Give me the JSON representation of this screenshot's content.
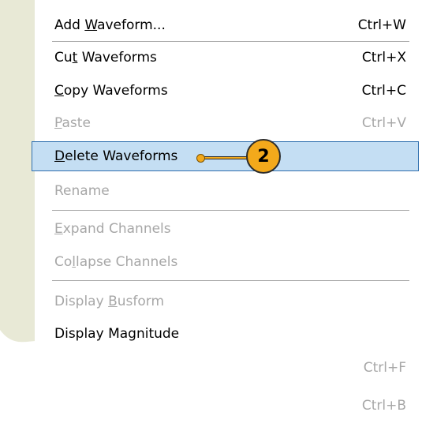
{
  "menu": {
    "items": [
      {
        "label_pre": "Add ",
        "label_u": "W",
        "label_post": "aveform...",
        "shortcut": "Ctrl+W",
        "state": "enabled"
      },
      {
        "label_pre": "Cu",
        "label_u": "t",
        "label_post": " Waveforms",
        "shortcut": "Ctrl+X",
        "state": "enabled"
      },
      {
        "label_pre": "",
        "label_u": "C",
        "label_post": "opy Waveforms",
        "shortcut": "Ctrl+C",
        "state": "enabled"
      },
      {
        "label_pre": "",
        "label_u": "P",
        "label_post": "aste",
        "shortcut": "Ctrl+V",
        "state": "disabled"
      },
      {
        "label_pre": "",
        "label_u": "D",
        "label_post": "elete Waveforms",
        "shortcut": "",
        "state": "highlighted"
      },
      {
        "label_pre": "Rename",
        "label_u": "",
        "label_post": "",
        "shortcut": "",
        "state": "disabled"
      },
      {
        "label_pre": "",
        "label_u": "E",
        "label_post": "xpand Channels",
        "shortcut": "",
        "state": "disabled"
      },
      {
        "label_pre": "Co",
        "label_u": "l",
        "label_post": "lapse Channels",
        "shortcut": "",
        "state": "disabled"
      },
      {
        "label_pre": "Display ",
        "label_u": "B",
        "label_post": "usform",
        "shortcut": "",
        "state": "disabled"
      },
      {
        "label_pre": "Display Magnitude",
        "label_u": "",
        "label_post": "",
        "shortcut": "",
        "state": "enabled"
      }
    ],
    "hidden_shortcuts": [
      "Ctrl+F",
      "Ctrl+B"
    ]
  },
  "callout": {
    "number": "2",
    "color": "#f3a91b"
  }
}
